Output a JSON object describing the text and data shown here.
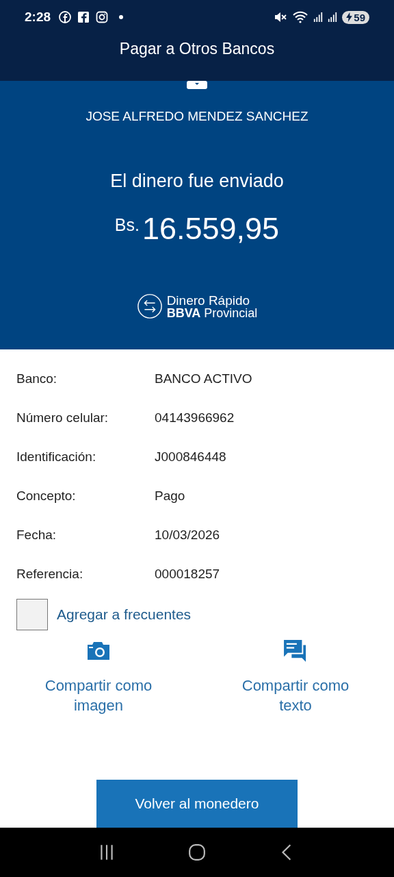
{
  "status_bar": {
    "time": "2:28",
    "battery": "59"
  },
  "header": {
    "title": "Pagar a Otros Bancos"
  },
  "receipt": {
    "recipient": "JOSE ALFREDO MENDEZ SANCHEZ",
    "message": "El dinero fue enviado",
    "currency": "Bs.",
    "amount": "16.559,95",
    "logo_line_1": "Dinero Rápido",
    "logo_line_2": "**BBVA** Provincial"
  },
  "details": [
    {
      "label": "Banco:",
      "value": "BANCO ACTIVO"
    },
    {
      "label": "Número celular:",
      "value": "04143966962"
    },
    {
      "label": "Identificación:",
      "value": "J000846448"
    },
    {
      "label": "Concepto:",
      "value": "Pago"
    },
    {
      "label": "Fecha:",
      "value": "10/03/2026"
    },
    {
      "label": "Referencia:",
      "value": "000018257"
    }
  ],
  "favorite": {
    "label": "Agregar a frecuentes",
    "checked": false
  },
  "share_actions": [
    {
      "kind": "image",
      "label": "Compartir como imagen"
    },
    {
      "kind": "text",
      "label": "Compartir como texto"
    }
  ],
  "primary_button": "Volver al monedero"
}
